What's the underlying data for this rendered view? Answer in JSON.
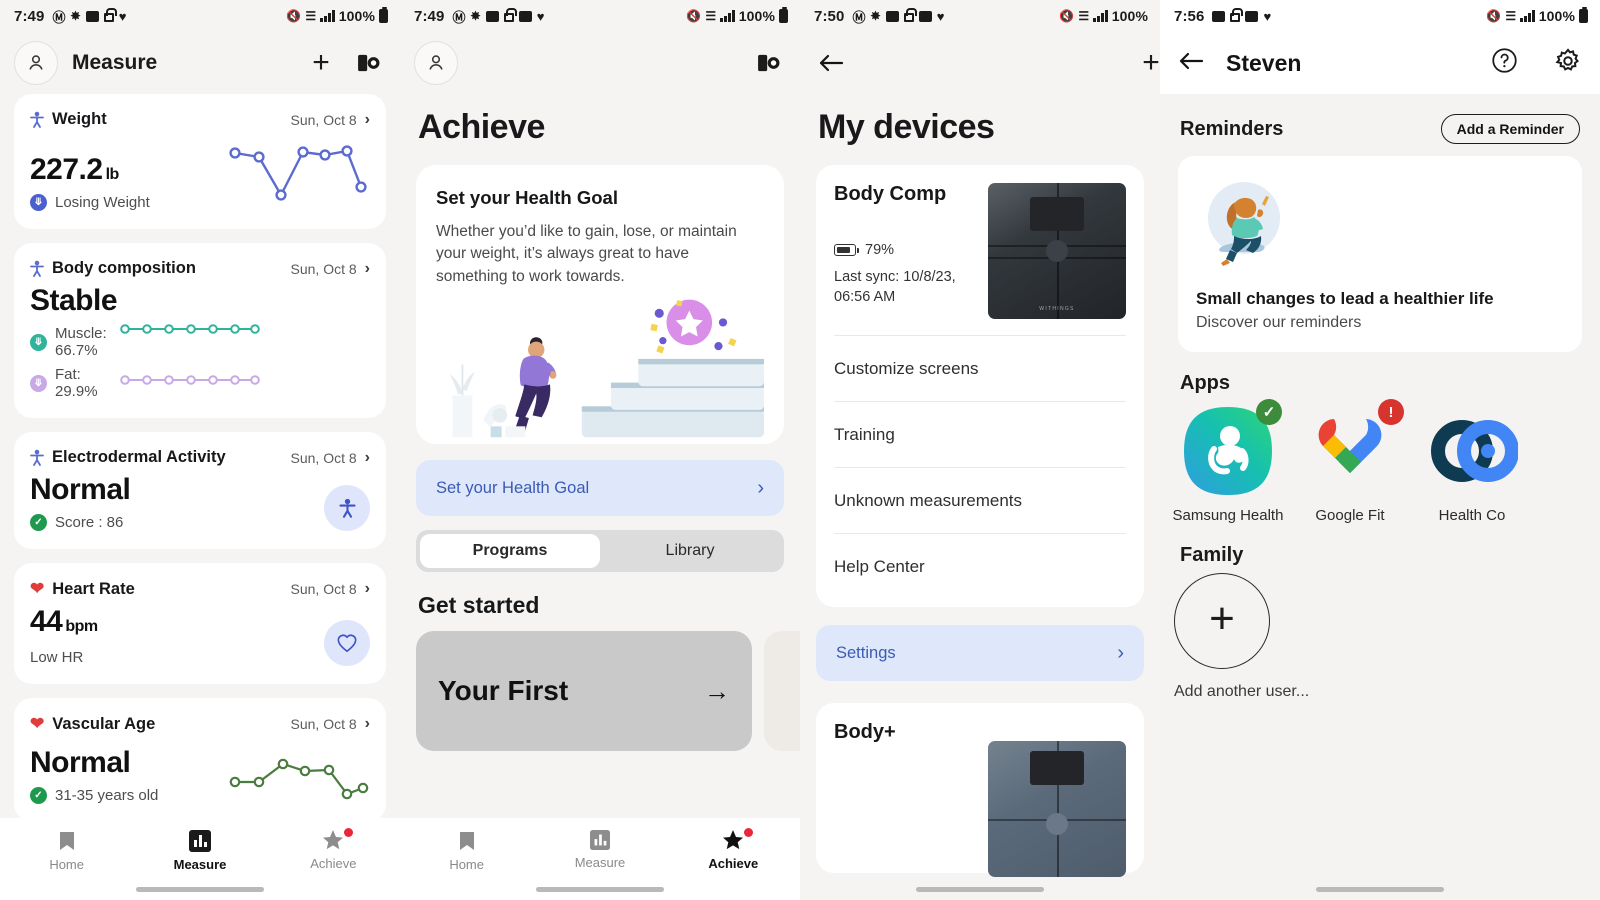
{
  "panels": {
    "measure": {
      "status": {
        "time": "7:49",
        "battery": "100%",
        "icons": [
          "gmail-icon",
          "pinwheel-icon",
          "bitmoji-icon",
          "lock-icon",
          "heart-icon"
        ]
      },
      "header": {
        "title": "Measure",
        "avatar": "profile-icon",
        "add": "plus-icon",
        "device": "device-icon"
      },
      "cards": [
        {
          "icon": "body-icon",
          "icon_color": "#5b6bd0",
          "title": "Weight",
          "date": "Sun, Oct 8",
          "value": "227.2",
          "unit": "lb",
          "status_text": "Losing Weight",
          "status_icon": "trend-down-icon",
          "status_color": "#4b5fd1",
          "viz": "weight-sparkline"
        },
        {
          "icon": "body-icon",
          "icon_color": "#5b6bd0",
          "title": "Body composition",
          "date": "Sun, Oct 8",
          "value": "Stable",
          "unit": "",
          "muscle": "Muscle: 66.7%",
          "fat": "Fat: 29.9%",
          "muscle_color": "#2fb39b",
          "fat_color": "#b89ade",
          "viz": "composition-sparklines"
        },
        {
          "icon": "body-icon",
          "icon_color": "#5b6bd0",
          "title": "Electrodermal Activity",
          "date": "Sun, Oct 8",
          "value": "Normal",
          "status_text": "Score : 86",
          "status_icon": "check-icon",
          "status_color": "#1d9a4e",
          "viz": "body-badge"
        },
        {
          "icon": "heart-icon",
          "icon_color": "#e03c3c",
          "title": "Heart Rate",
          "date": "Sun, Oct 8",
          "value": "44",
          "unit": "bpm",
          "status_text": "Low HR",
          "viz": "heart-badge"
        },
        {
          "icon": "heart-icon",
          "icon_color": "#e03c3c",
          "title": "Vascular Age",
          "date": "Sun, Oct 8",
          "value": "Normal",
          "status_text": "31-35 years old",
          "status_icon": "check-icon",
          "status_color": "#1d9a4e",
          "viz": "vascular-sparkline"
        }
      ],
      "nav": [
        {
          "label": "Home",
          "icon": "home-bookmark-icon",
          "active": false,
          "badge": false
        },
        {
          "label": "Measure",
          "icon": "bars-icon",
          "active": true,
          "badge": false
        },
        {
          "label": "Achieve",
          "icon": "star-icon",
          "active": false,
          "badge": true
        }
      ]
    },
    "achieve": {
      "status": {
        "time": "7:49",
        "battery": "100%"
      },
      "header": {
        "avatar": "profile-icon",
        "device": "device-icon"
      },
      "page_title": "Achieve",
      "goal_card": {
        "title": "Set your Health Goal",
        "body": "Whether you’d like to gain, lose, or maintain your weight, it’s always great to have something to work towards.",
        "illustration": "person-climbing-stairs-illustration"
      },
      "cta": {
        "label": "Set your Health Goal",
        "chevron": "chevron-right-icon"
      },
      "segments": [
        {
          "label": "Programs",
          "active": true
        },
        {
          "label": "Library",
          "active": false
        }
      ],
      "section_title": "Get started",
      "programs": [
        {
          "title": "Your First",
          "arrow": "arrow-right-icon"
        }
      ],
      "nav": [
        {
          "label": "Home",
          "icon": "home-bookmark-icon",
          "active": false,
          "badge": false
        },
        {
          "label": "Measure",
          "icon": "bars-icon",
          "active": false,
          "badge": false
        },
        {
          "label": "Achieve",
          "icon": "star-icon",
          "active": true,
          "badge": true
        }
      ]
    },
    "devices": {
      "status": {
        "time": "7:50",
        "battery": "100%"
      },
      "header": {
        "back": "back-arrow-icon",
        "add": "plus-icon"
      },
      "page_title": "My devices",
      "device": {
        "name": "Body Comp",
        "battery": "79%",
        "last_sync": "Last sync: 10/8/23, 06:56 AM",
        "image": "withings-body-comp-scale",
        "brand": "WITHINGS",
        "links": [
          "Customize screens",
          "Training",
          "Unknown measurements",
          "Help Center"
        ]
      },
      "settings": {
        "label": "Settings",
        "chevron": "chevron-right-icon"
      },
      "device2": {
        "name": "Body+",
        "image": "withings-body-plus-scale"
      }
    },
    "profile": {
      "status": {
        "time": "7:56",
        "battery": "100%"
      },
      "header": {
        "back": "back-arrow-icon",
        "title": "Steven",
        "help": "help-icon",
        "settings": "gear-icon"
      },
      "reminders": {
        "section": "Reminders",
        "button": "Add a Reminder",
        "card_title": "Small changes to lead a healthier life",
        "card_sub": "Discover our reminders",
        "illustration": "person-sitting-illustration"
      },
      "apps": {
        "section": "Apps",
        "items": [
          {
            "label": "Samsung Health",
            "icon": "samsung-health-icon",
            "badge": "check",
            "badge_color": "#3c8c3c"
          },
          {
            "label": "Google Fit",
            "icon": "google-fit-icon",
            "badge": "alert",
            "badge_color": "#d6342c"
          },
          {
            "label": "Health Co",
            "icon": "health-connect-icon",
            "badge": "none",
            "badge_color": ""
          }
        ]
      },
      "family": {
        "section": "Family",
        "add_label": "Add another user...",
        "add_icon": "plus-icon"
      }
    }
  },
  "chart_data": [
    {
      "type": "line",
      "title": "Weight trend sparkline",
      "color": "#5b6bd0",
      "x": [
        0,
        1,
        2,
        3,
        4,
        5,
        6,
        7
      ],
      "values": [
        232,
        231,
        220,
        232,
        232,
        232,
        232,
        224
      ],
      "ylabel": "lb",
      "xlabel": "",
      "grid": false,
      "legend": "none"
    },
    {
      "type": "line",
      "title": "Muscle sparkline",
      "color": "#2fb39b",
      "x": [
        0,
        1,
        2,
        3,
        4,
        5,
        6
      ],
      "values": [
        66.7,
        66.7,
        66.7,
        66.7,
        66.7,
        66.7,
        66.7
      ],
      "ylabel": "%",
      "xlabel": "",
      "grid": false,
      "legend": "none"
    },
    {
      "type": "line",
      "title": "Fat sparkline",
      "color": "#c9a9e5",
      "x": [
        0,
        1,
        2,
        3,
        4,
        5,
        6
      ],
      "values": [
        29.9,
        29.9,
        29.9,
        29.9,
        29.9,
        29.9,
        29.9
      ],
      "ylabel": "%",
      "xlabel": "",
      "grid": false,
      "legend": "none"
    },
    {
      "type": "line",
      "title": "Vascular age sparkline",
      "color": "#4a7c3f",
      "x": [
        0,
        1,
        2,
        3,
        4,
        5,
        6,
        7
      ],
      "values": [
        33,
        33,
        38,
        36,
        36,
        30,
        30.5,
        31
      ],
      "ylabel": "years",
      "xlabel": "",
      "grid": false,
      "legend": "none"
    }
  ]
}
